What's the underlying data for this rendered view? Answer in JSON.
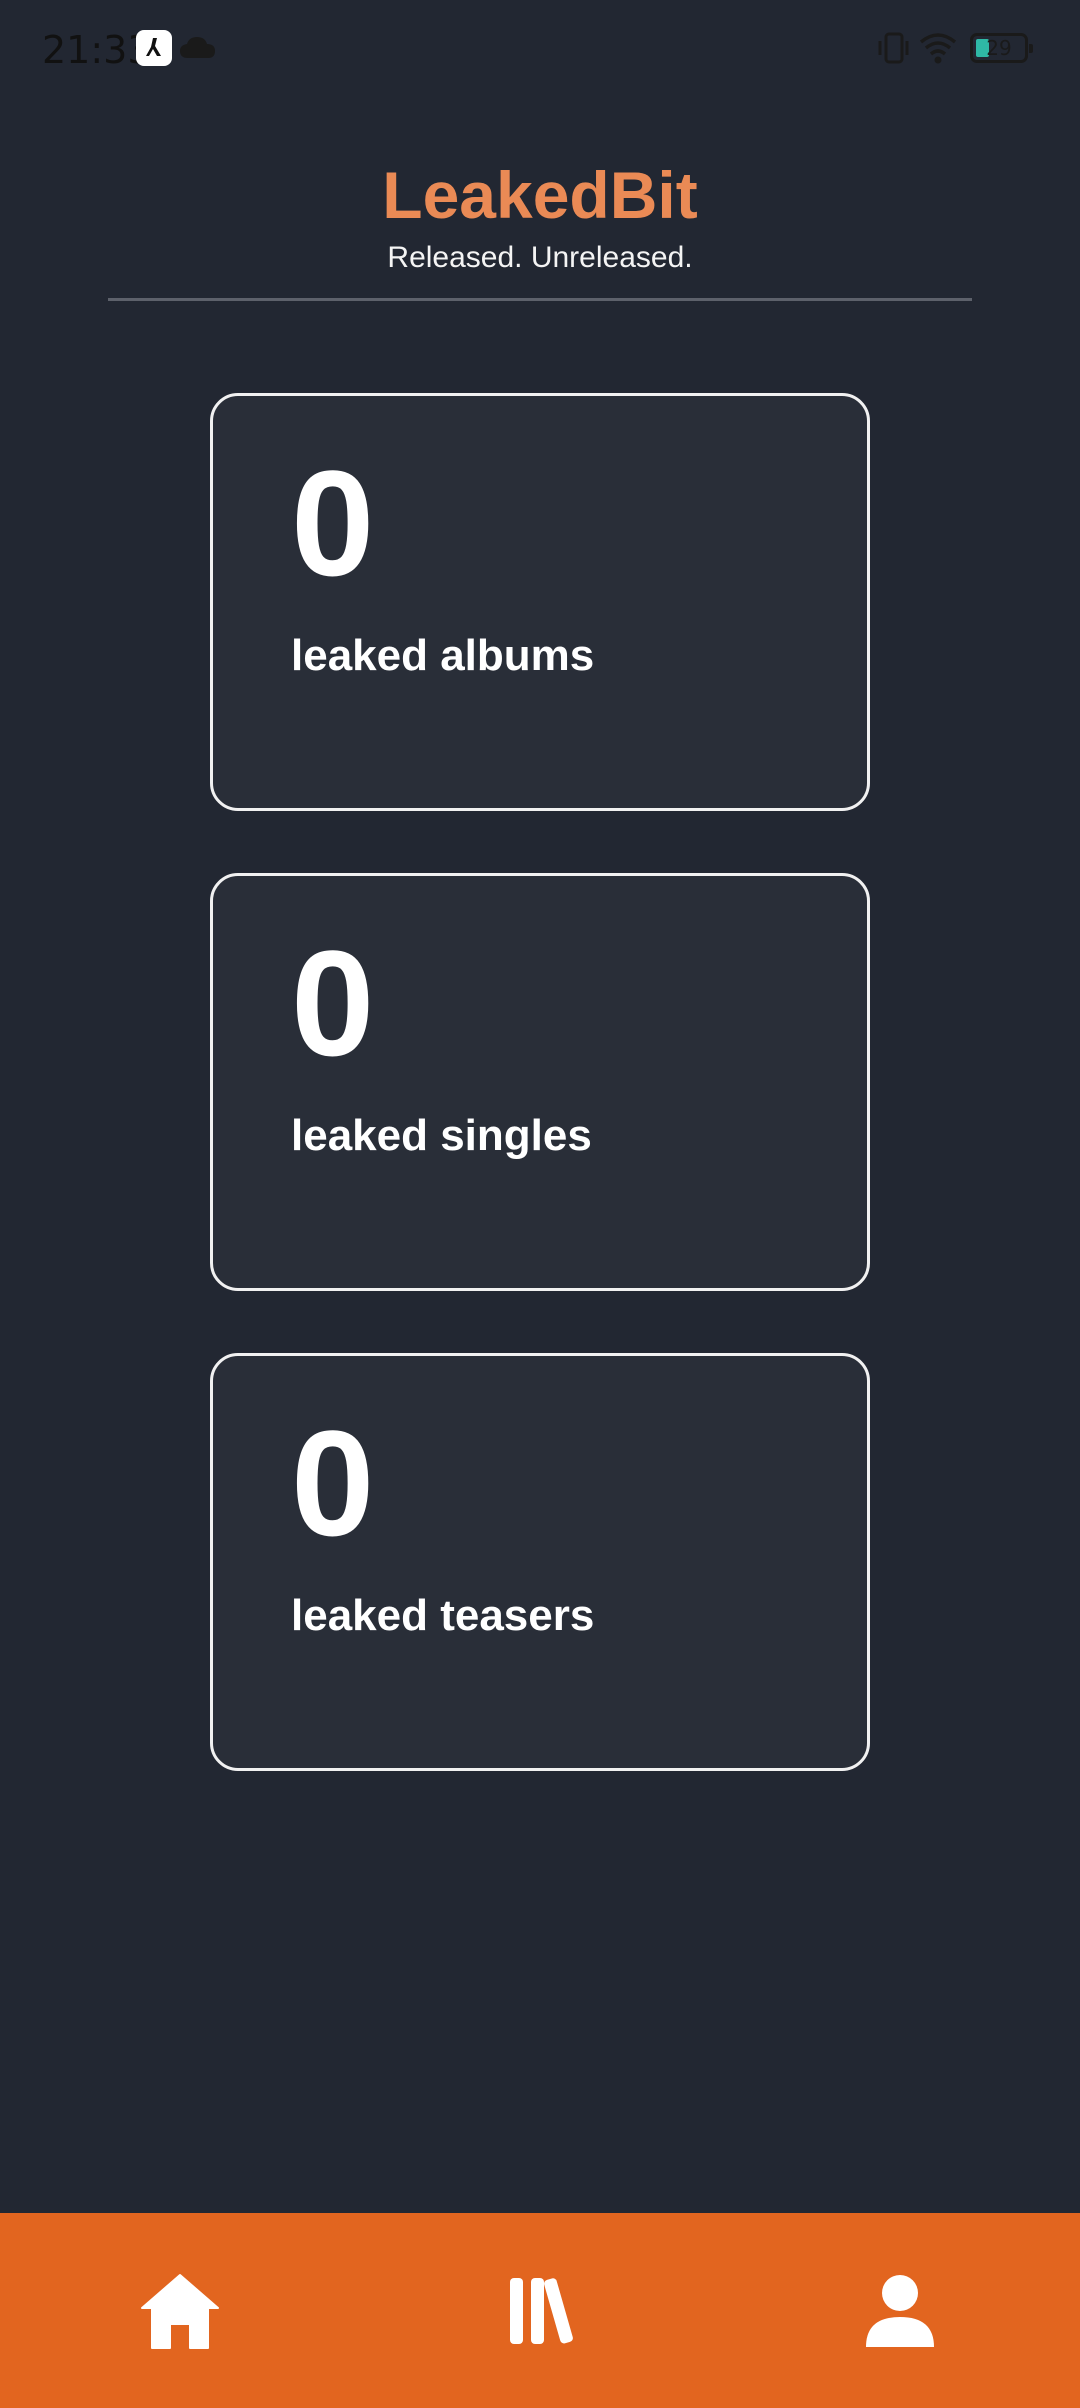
{
  "status_bar": {
    "time": "21:33",
    "battery_level": "29"
  },
  "header": {
    "title": "LeakedBit",
    "subtitle": "Released. Unreleased."
  },
  "stats": [
    {
      "value": "0",
      "label": "leaked albums"
    },
    {
      "value": "0",
      "label": "leaked singles"
    },
    {
      "value": "0",
      "label": "leaked teasers"
    }
  ],
  "bottom_nav": {
    "items": [
      {
        "icon": "home-icon"
      },
      {
        "icon": "library-icon"
      },
      {
        "icon": "profile-icon"
      }
    ]
  },
  "colors": {
    "background": "#222732",
    "card_background": "#292e38",
    "accent": "#ea8a55",
    "nav_background": "#e2651f"
  }
}
